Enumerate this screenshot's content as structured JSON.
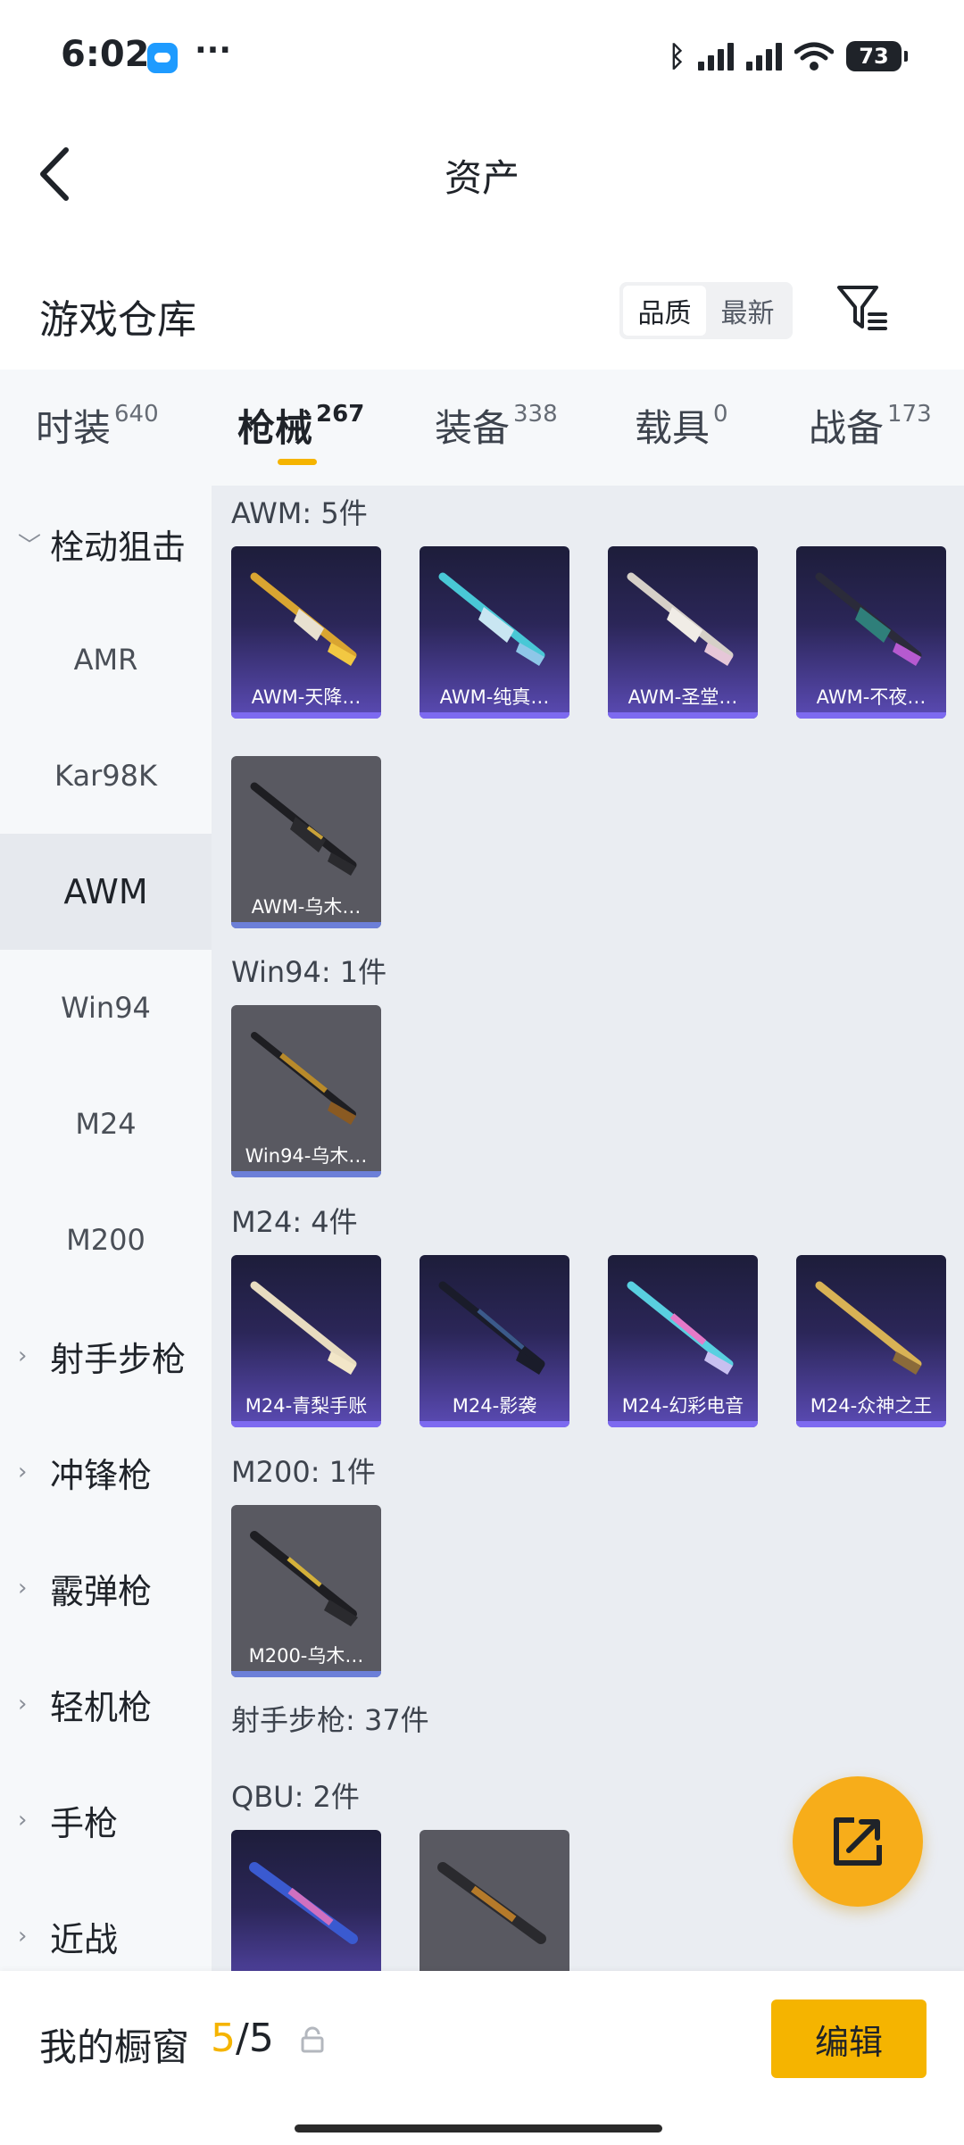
{
  "status_bar": {
    "time": "6:02",
    "dots": "···",
    "battery": "73"
  },
  "header": {
    "title": "资产"
  },
  "section": {
    "title": "游戏仓库",
    "sort_options": [
      "品质",
      "最新"
    ]
  },
  "tabs": [
    {
      "label": "时装",
      "count": "640"
    },
    {
      "label": "枪械",
      "count": "267"
    },
    {
      "label": "装备",
      "count": "338"
    },
    {
      "label": "载具",
      "count": "0"
    },
    {
      "label": "战备",
      "count": "173"
    }
  ],
  "sidebar": {
    "group_open": "栓动狙击",
    "sub_items": [
      "AMR",
      "Kar98K",
      "AWM",
      "Win94",
      "M24",
      "M200"
    ],
    "groups": [
      "射手步枪",
      "冲锋枪",
      "霰弹枪",
      "轻机枪",
      "手枪",
      "近战"
    ]
  },
  "content": {
    "groups": [
      {
        "label": "AWM: 5件",
        "items": [
          "AWM-天降…",
          "AWM-纯真…",
          "AWM-圣堂…",
          "AWM-不夜…",
          "AWM-乌木…"
        ]
      },
      {
        "label": "Win94: 1件",
        "items": [
          "Win94-乌木…"
        ]
      },
      {
        "label": "M24: 4件",
        "items": [
          "M24-青梨手账",
          "M24-影袭",
          "M24-幻彩电音",
          "M24-众神之王"
        ]
      },
      {
        "label": "M200: 1件",
        "items": [
          "M200-乌木…"
        ]
      }
    ],
    "marksman_label": "射手步枪: 37件",
    "qbu_label": "QBU: 2件"
  },
  "bottom": {
    "label": "我的橱窗",
    "count_current": "5",
    "count_total": "/5",
    "edit_label": "编辑"
  },
  "colors": {
    "accent": "#f5b400",
    "card_purple": "#5b4bb5",
    "card_gray": "#595961"
  }
}
